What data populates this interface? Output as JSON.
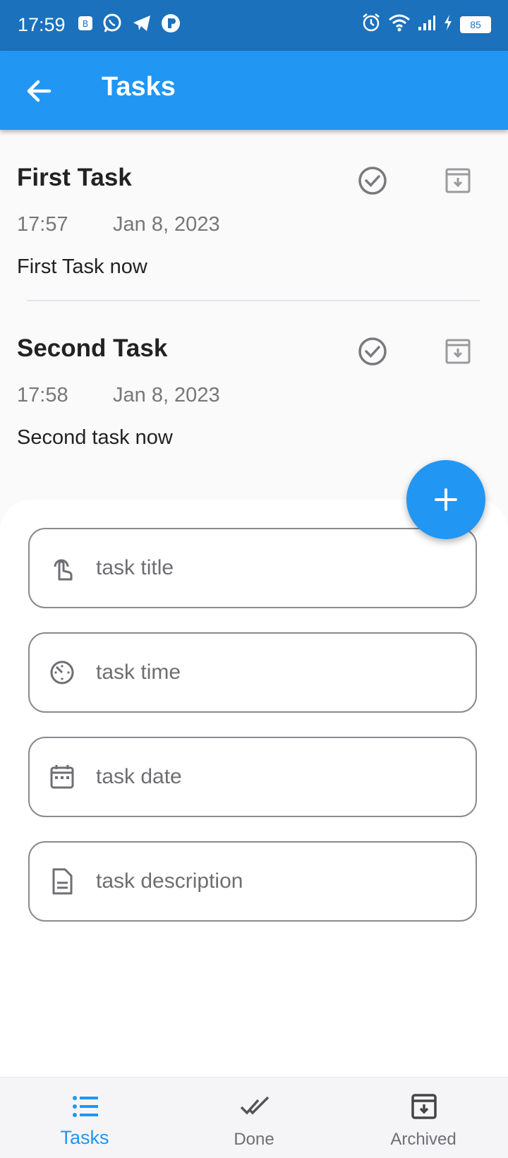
{
  "status_bar": {
    "time": "17:59",
    "battery": "85"
  },
  "app_bar": {
    "title": "Tasks"
  },
  "tasks": [
    {
      "title": "First Task",
      "time": "17:57",
      "date": "Jan 8, 2023",
      "description": "First Task now"
    },
    {
      "title": "Second Task",
      "time": "17:58",
      "date": "Jan 8, 2023",
      "description": "Second task now"
    }
  ],
  "form": {
    "title_placeholder": "task title",
    "time_placeholder": "task time",
    "date_placeholder": "task date",
    "description_placeholder": "task description"
  },
  "fab": {
    "icon": "plus-icon"
  },
  "bottom_nav": {
    "items": [
      {
        "label": "Tasks",
        "icon": "list-icon",
        "active": true
      },
      {
        "label": "Done",
        "icon": "done-all-icon",
        "active": false
      },
      {
        "label": "Archived",
        "icon": "archive-icon",
        "active": false
      }
    ]
  },
  "colors": {
    "primary": "#2196F3",
    "status_bar": "#1B71BC",
    "muted": "#777777"
  }
}
